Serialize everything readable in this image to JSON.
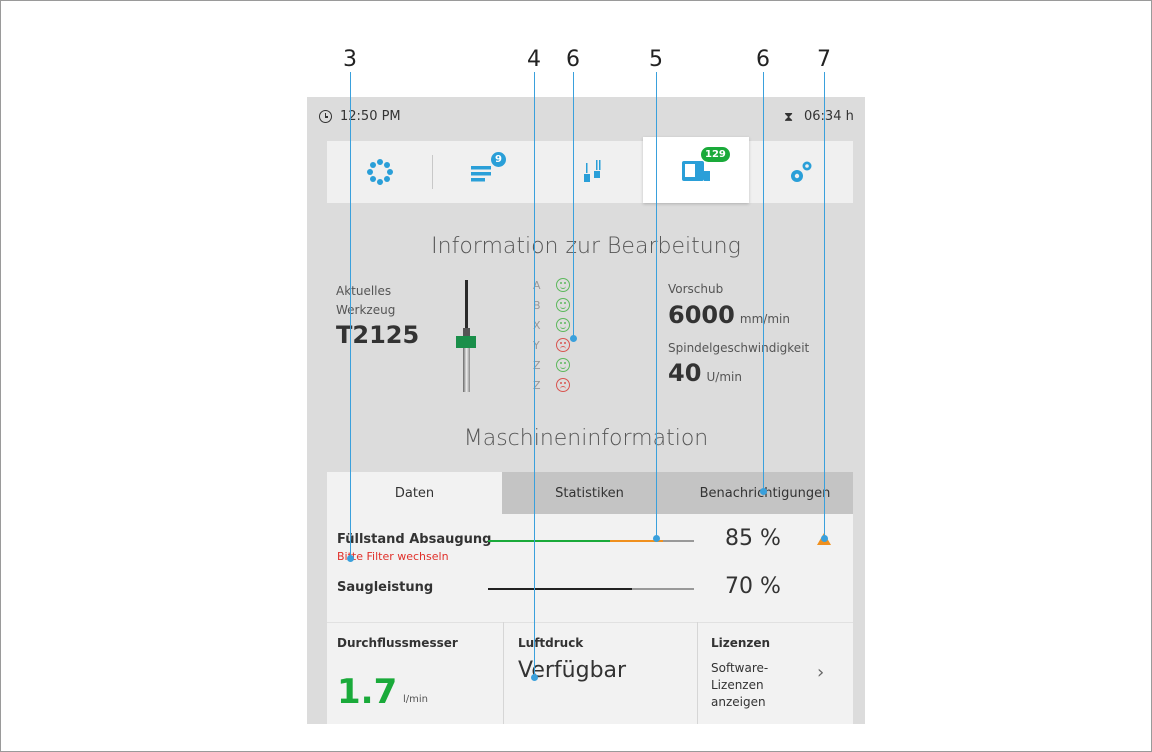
{
  "callouts": [
    "3",
    "4",
    "6",
    "5",
    "6",
    "7"
  ],
  "status_bar": {
    "time": "12:50 PM",
    "duration": "06:34 h"
  },
  "nav": {
    "items": [
      {
        "name": "overview",
        "icon": "dots-circle-icon"
      },
      {
        "name": "jobs",
        "icon": "job-list-icon",
        "badge": "9"
      },
      {
        "name": "tools",
        "icon": "tools-icon"
      },
      {
        "name": "machine",
        "icon": "machine-icon",
        "badge": "129",
        "active": true
      },
      {
        "name": "settings",
        "icon": "gears-icon"
      }
    ],
    "accent_color": "#2a9fd8",
    "badge_color": "#1aaa3a"
  },
  "processing": {
    "title": "Information zur Bearbeitung",
    "current_tool_label_1": "Aktuelles",
    "current_tool_label_2": "Werkzeug",
    "current_tool_value": "T2125",
    "axes": [
      {
        "letter": "A",
        "state": "happy"
      },
      {
        "letter": "B",
        "state": "happy"
      },
      {
        "letter": "X",
        "state": "happy"
      },
      {
        "letter": "Y",
        "state": "sad"
      },
      {
        "letter": "Z",
        "state": "happy"
      },
      {
        "letter": "Z",
        "state": "sad"
      }
    ],
    "feed_label": "Vorschub",
    "feed_value": "6000",
    "feed_unit": "mm/min",
    "spindle_label": "Spindelgeschwindigkeit",
    "spindle_value": "40",
    "spindle_unit": "U/min"
  },
  "machine": {
    "title": "Maschineninformation",
    "tabs": [
      "Daten",
      "Statistiken",
      "Benachrichtigungen"
    ],
    "active_tab": "Daten",
    "fill_level": {
      "label": "Füllstand Absaugung",
      "warning": "Bitte Filter wechseln",
      "value_text": "85 %",
      "value": 85,
      "warn_color": "#f0901e"
    },
    "suction": {
      "label": "Saugleistung",
      "value_text": "70 %",
      "value": 70
    },
    "flow": {
      "title": "Durchflussmesser",
      "value": "1.7",
      "unit": "l/min"
    },
    "air_pressure": {
      "title": "Luftdruck",
      "value": "Verfügbar"
    },
    "licenses": {
      "title": "Lizenzen",
      "link": "Software-Lizenzen anzeigen"
    }
  }
}
